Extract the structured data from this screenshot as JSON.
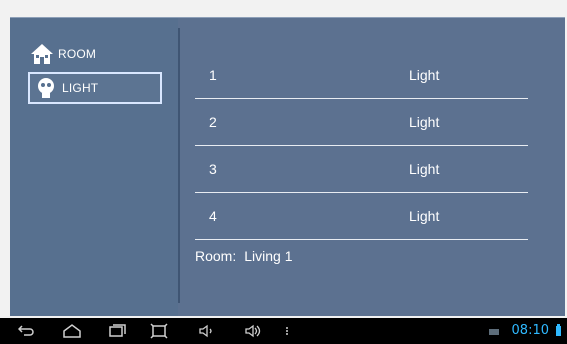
{
  "sidebar": {
    "items": [
      {
        "label": "ROOM",
        "icon": "house-icon"
      },
      {
        "label": "LIGHT",
        "icon": "bulb-icon"
      }
    ]
  },
  "list": {
    "rows": [
      {
        "num": "1",
        "type": "Light"
      },
      {
        "num": "2",
        "type": "Light"
      },
      {
        "num": "3",
        "type": "Light"
      },
      {
        "num": "4",
        "type": "Light"
      }
    ]
  },
  "room": {
    "label": "Room:",
    "value": "Living 1"
  },
  "statusbar": {
    "time": "08:10"
  },
  "colors": {
    "panel": "#5c7190",
    "clock": "#2fb9ff"
  }
}
